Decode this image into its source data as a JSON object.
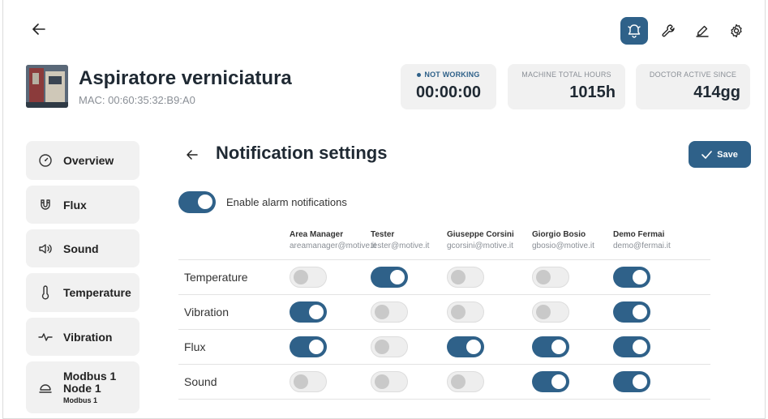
{
  "machine": {
    "title": "Aspiratore verniciatura",
    "mac": "MAC: 00:60:35:32:B9:A0"
  },
  "stats": [
    {
      "label": "NOT WORKING",
      "value": "00:00:00"
    },
    {
      "label": "MACHINE TOTAL HOURS",
      "value": "1015h"
    },
    {
      "label": "DOCTOR ACTIVE SINCE",
      "value": "414gg"
    }
  ],
  "top_icons": [
    "bell-icon",
    "wrench-icon",
    "edit-icon",
    "gear-icon"
  ],
  "sidebar": {
    "items": [
      {
        "label": "Overview",
        "icon": "gauge-icon"
      },
      {
        "label": "Flux",
        "icon": "magnet-icon"
      },
      {
        "label": "Sound",
        "icon": "speaker-icon"
      },
      {
        "label": "Temperature",
        "icon": "thermometer-icon"
      },
      {
        "label": "Vibration",
        "icon": "pulse-icon"
      },
      {
        "label": "Modbus 1 Node 1",
        "sub": "Modbus 1",
        "icon": "machine-icon"
      }
    ]
  },
  "notifications": {
    "title": "Notification settings",
    "save_label": "Save",
    "enable_label": "Enable alarm notifications",
    "enable_on": true,
    "users": [
      {
        "name": "Area Manager",
        "email": "areamanager@motive.it"
      },
      {
        "name": "Tester",
        "email": "tester@motive.it"
      },
      {
        "name": "Giuseppe Corsini",
        "email": "gcorsini@motive.it"
      },
      {
        "name": "Giorgio Bosio",
        "email": "gbosio@motive.it"
      },
      {
        "name": "Demo Fermai",
        "email": "demo@fermai.it"
      }
    ],
    "rows": [
      {
        "label": "Temperature",
        "values": [
          false,
          true,
          false,
          false,
          true
        ]
      },
      {
        "label": "Vibration",
        "values": [
          true,
          false,
          false,
          false,
          true
        ]
      },
      {
        "label": "Flux",
        "values": [
          true,
          false,
          true,
          true,
          true
        ]
      },
      {
        "label": "Sound",
        "values": [
          false,
          false,
          false,
          true,
          true
        ]
      }
    ]
  },
  "colors": {
    "accent": "#2f6189",
    "panel": "#f1f1f1"
  }
}
